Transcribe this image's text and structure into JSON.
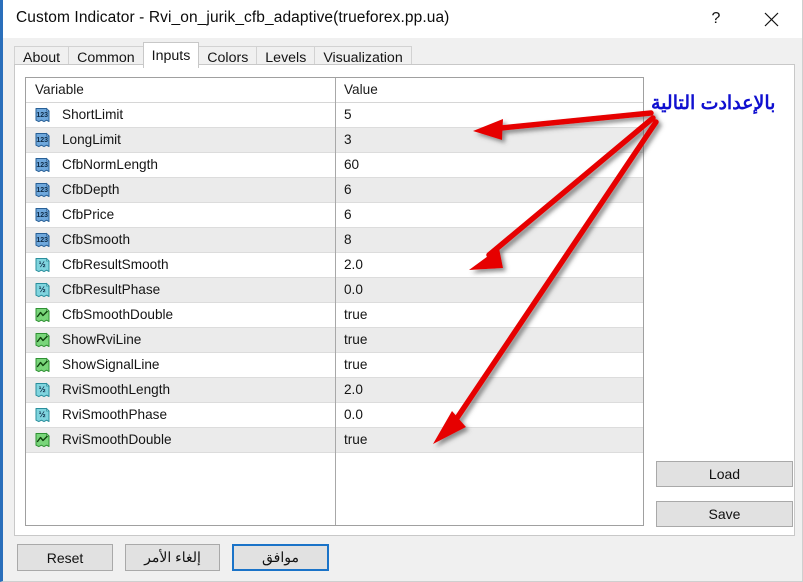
{
  "window": {
    "title": "Custom Indicator - Rvi_on_jurik_cfb_adaptive(trueforex.pp.ua)",
    "help_label": "?",
    "close_label": "×"
  },
  "tabs": [
    {
      "label": "About",
      "active": false
    },
    {
      "label": "Common",
      "active": false
    },
    {
      "label": "Inputs",
      "active": true
    },
    {
      "label": "Colors",
      "active": false
    },
    {
      "label": "Levels",
      "active": false
    },
    {
      "label": "Visualization",
      "active": false
    }
  ],
  "table": {
    "headers": {
      "variable": "Variable",
      "value": "Value"
    },
    "rows": [
      {
        "icon": "int-icon",
        "name": "ShortLimit",
        "value": "5"
      },
      {
        "icon": "int-icon",
        "name": "LongLimit",
        "value": "3"
      },
      {
        "icon": "int-icon",
        "name": "CfbNormLength",
        "value": "60"
      },
      {
        "icon": "int-icon",
        "name": "CfbDepth",
        "value": "6"
      },
      {
        "icon": "int-icon",
        "name": "CfbPrice",
        "value": "6"
      },
      {
        "icon": "int-icon",
        "name": "CfbSmooth",
        "value": "8"
      },
      {
        "icon": "double-icon",
        "name": "CfbResultSmooth",
        "value": "2.0"
      },
      {
        "icon": "double-icon",
        "name": "CfbResultPhase",
        "value": "0.0"
      },
      {
        "icon": "bool-icon",
        "name": "CfbSmoothDouble",
        "value": "true"
      },
      {
        "icon": "bool-icon",
        "name": "ShowRviLine",
        "value": "true"
      },
      {
        "icon": "bool-icon",
        "name": "ShowSignalLine",
        "value": "true"
      },
      {
        "icon": "double-icon",
        "name": "RviSmoothLength",
        "value": "2.0"
      },
      {
        "icon": "double-icon",
        "name": "RviSmoothPhase",
        "value": "0.0"
      },
      {
        "icon": "bool-icon",
        "name": "RviSmoothDouble",
        "value": "true"
      }
    ]
  },
  "side_buttons": {
    "load_label": "Load",
    "save_label": "Save"
  },
  "footer": {
    "reset_label": "Reset",
    "cancel_label": "إلغاء الأمر",
    "ok_label": "موافق"
  },
  "annotation": {
    "text": "بالإعدادت التالية",
    "text_color": "#1010d0",
    "arrow_color": "#e60000"
  }
}
